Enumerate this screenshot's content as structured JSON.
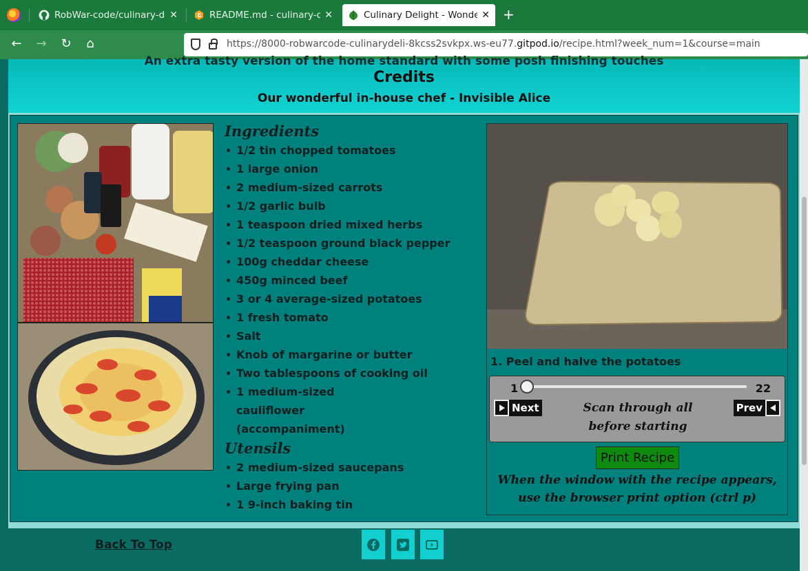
{
  "browser": {
    "tabs": [
      {
        "label": "RobWar-code/culinary-delig",
        "icon": "github-icon"
      },
      {
        "label": "README.md - culinary-delig",
        "icon": "gitpod-icon"
      },
      {
        "label": "Culinary Delight - Wonderfu",
        "icon": "leaf-icon"
      }
    ],
    "url_prefix": "https://8000-robwarcode-culinarydeli-8kcss2svkpx.ws-eu77.",
    "url_domain": "gitpod.io",
    "url_suffix": "/recipe.html?week_num=1&course=main"
  },
  "header": {
    "description": "An extra tasty version of the home standard with some posh finishing touches",
    "credits_heading": "Credits",
    "chef": "Our wonderful in-house chef - Invisible Alice"
  },
  "ingredients": {
    "heading": "Ingredients",
    "items": [
      "1/2 tin chopped tomatoes",
      "1 large onion",
      "2 medium-sized carrots",
      "1/2 garlic bulb",
      "1 teaspoon dried mixed herbs",
      "1/2 teaspoon ground black pepper",
      "100g cheddar cheese",
      "450g minced beef",
      "3 or 4 average-sized potatoes",
      "1 fresh tomato",
      "Salt",
      "Knob of margarine or butter",
      "Two tablespoons of cooking oil",
      "1 medium-sized cauliflower (accompaniment)"
    ]
  },
  "utensils": {
    "heading": "Utensils",
    "items": [
      "2 medium-sized saucepans",
      "Large frying pan",
      "1 9-inch baking tin"
    ]
  },
  "step": {
    "text": "1. Peel and halve the potatoes",
    "slider_min": "1",
    "slider_max": "22",
    "current_step": 1,
    "next_label": "Next",
    "prev_label": "Prev",
    "scan_text": "Scan through all before starting"
  },
  "print": {
    "button_label": "Print Recipe",
    "note": "When the window with the recipe appears, use the browser print option (ctrl p)"
  },
  "footer": {
    "back_to_top": "Back To Top",
    "social": [
      "facebook-icon",
      "twitter-icon",
      "youtube-icon"
    ]
  },
  "colors": {
    "page_bg": "#0a6b63",
    "recipe_bg": "#00817e",
    "header_accent": "#12d3d3",
    "print_button": "#0e8a0e"
  }
}
